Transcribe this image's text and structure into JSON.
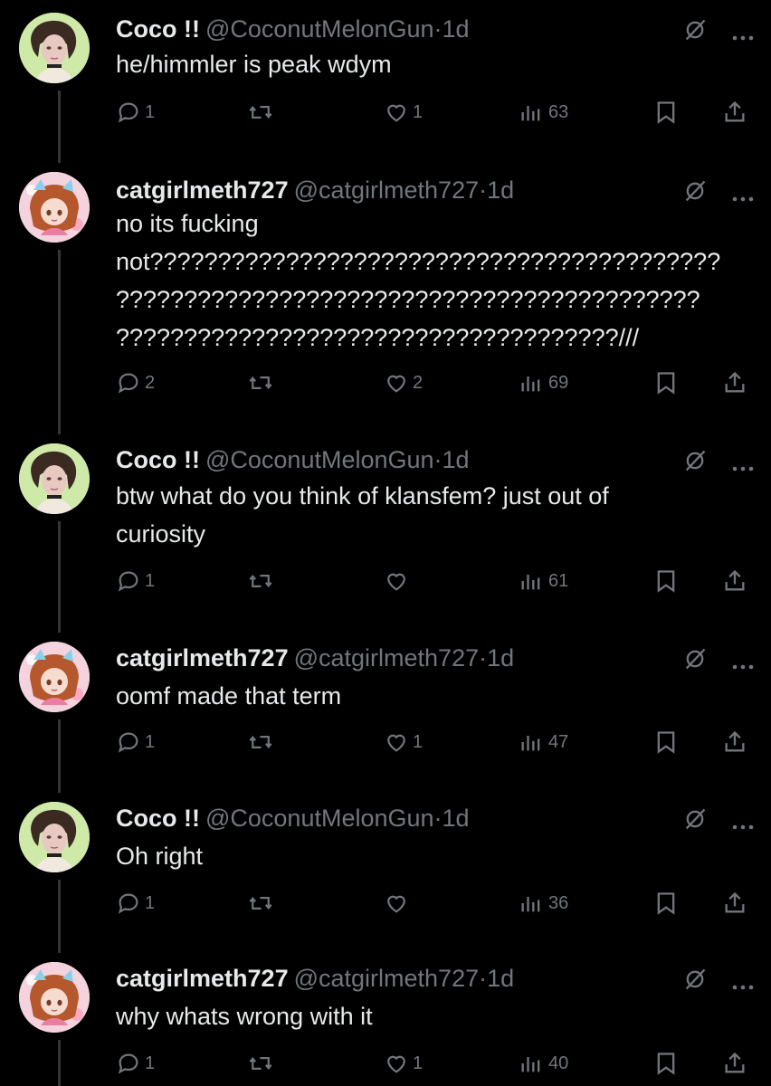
{
  "tweets": [
    {
      "author_name": "Coco !!",
      "handle": "@CoconutMelonGun",
      "separator": "·",
      "time": "1d",
      "text": "he/himmler is peak wdym",
      "replies": "1",
      "reposts": "",
      "likes": "1",
      "views": "63",
      "avatar_kind": "coco"
    },
    {
      "author_name": "catgirlmeth727",
      "handle": "@catgirlmeth727",
      "separator": "·",
      "time": "1d",
      "text": "no its fucking\nnot??????????????????????????????????????????\n???????????????????????????????????????????\n?????????????????????????????????????///",
      "replies": "2",
      "reposts": "",
      "likes": "2",
      "views": "69",
      "avatar_kind": "cat"
    },
    {
      "author_name": "Coco !!",
      "handle": "@CoconutMelonGun",
      "separator": "·",
      "time": "1d",
      "text": "btw what do you think of klansfem? just out of\ncuriosity",
      "replies": "1",
      "reposts": "",
      "likes": "",
      "views": "61",
      "avatar_kind": "coco"
    },
    {
      "author_name": "catgirlmeth727",
      "handle": "@catgirlmeth727",
      "separator": "·",
      "time": "1d",
      "text": "oomf made that term",
      "replies": "1",
      "reposts": "",
      "likes": "1",
      "views": "47",
      "avatar_kind": "cat"
    },
    {
      "author_name": "Coco !!",
      "handle": "@CoconutMelonGun",
      "separator": "·",
      "time": "1d",
      "text": "Oh right",
      "replies": "1",
      "reposts": "",
      "likes": "",
      "views": "36",
      "avatar_kind": "coco"
    },
    {
      "author_name": "catgirlmeth727",
      "handle": "@catgirlmeth727",
      "separator": "·",
      "time": "1d",
      "text": "why whats wrong with it",
      "replies": "1",
      "reposts": "",
      "likes": "1",
      "views": "40",
      "avatar_kind": "cat"
    }
  ],
  "icons": {
    "grok": "grok-icon",
    "more": "more-icon",
    "reply": "reply-icon",
    "repost": "repost-icon",
    "like": "like-icon",
    "views": "views-icon",
    "bookmark": "bookmark-icon",
    "share": "share-icon"
  },
  "colors": {
    "background": "#000000",
    "text": "#e7e9ea",
    "muted": "#71767b",
    "thread_line": "#333639"
  }
}
